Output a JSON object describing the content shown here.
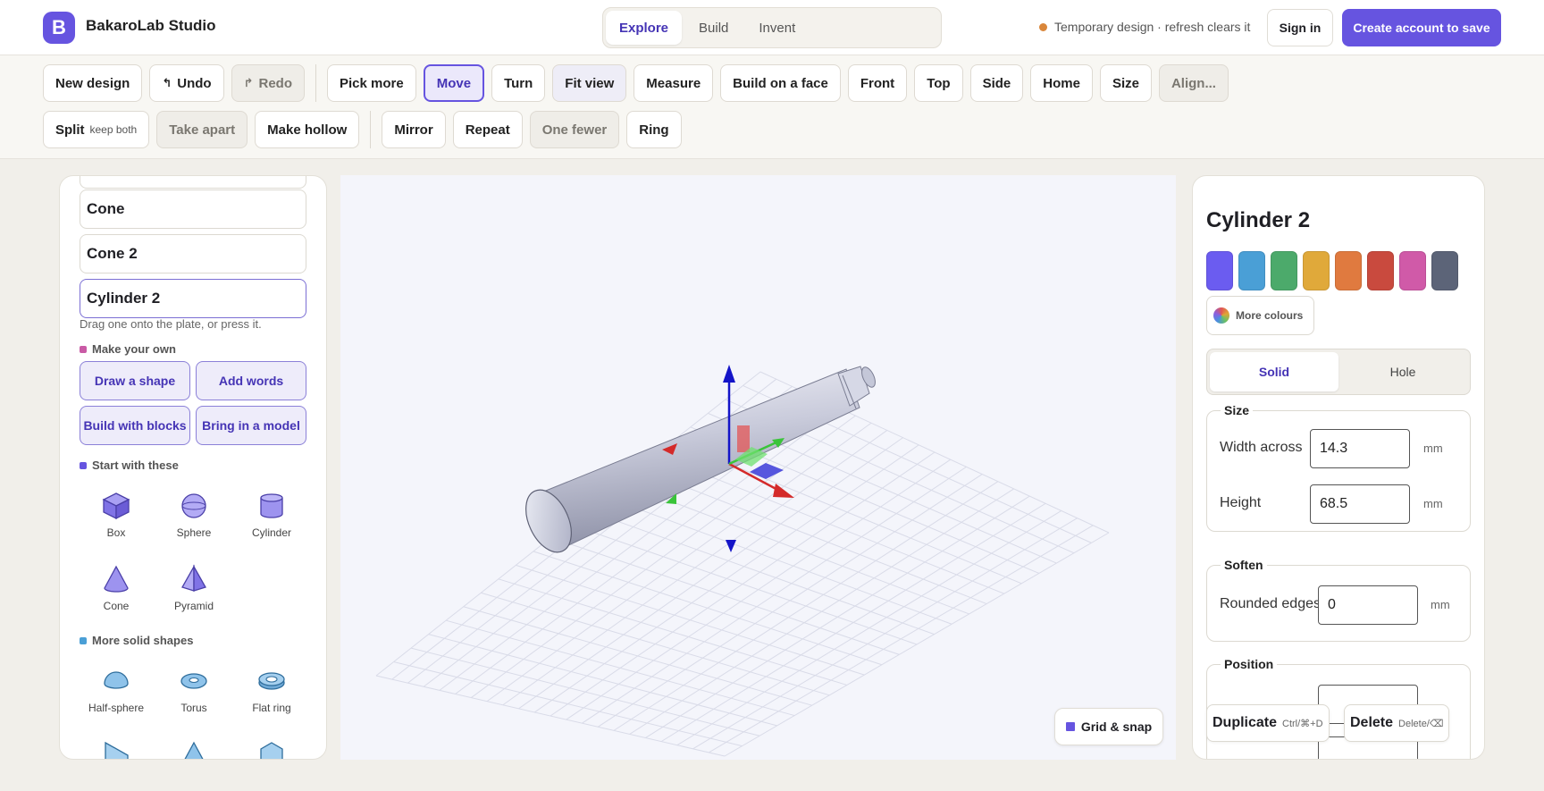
{
  "app": {
    "logo_letter": "B",
    "title": "BakaroLab Studio"
  },
  "modes": [
    "Explore",
    "Build",
    "Invent"
  ],
  "header": {
    "temp_note": "Temporary design · refresh clears it",
    "sign_in": "Sign in",
    "create_account": "Create account to save"
  },
  "toolbar": {
    "row1": [
      "New design",
      "Undo",
      "Redo",
      "Pick more",
      "Move",
      "Turn",
      "Fit view",
      "Measure",
      "Build on a face",
      "Front",
      "Top",
      "Side",
      "Home",
      "Size",
      "Align..."
    ],
    "split": "Split",
    "split_sub": "keep both",
    "row2": [
      "Take apart",
      "Make hollow",
      "Mirror",
      "Repeat",
      "One fewer",
      "Ring"
    ]
  },
  "left": {
    "items": [
      "Cone",
      "Cone 2",
      "Cylinder 2"
    ],
    "hint": "Drag one onto the plate, or press it.",
    "make_own": "Make your own",
    "make_buttons": [
      "Draw a shape",
      "Add words",
      "Build with blocks",
      "Bring in a model"
    ],
    "start_with": "Start with these",
    "basic_shapes": [
      "Box",
      "Sphere",
      "Cylinder",
      "Cone",
      "Pyramid"
    ],
    "more_solid": "More solid shapes",
    "more_shapes": [
      "Half-sphere",
      "Torus",
      "Flat ring"
    ],
    "section_colors": {
      "make": "#c95aa5",
      "start": "#6654e0",
      "more": "#4a9fd6"
    }
  },
  "viewport": {
    "grid_snap": "Grid & snap"
  },
  "right": {
    "title": "Cylinder 2",
    "colors": [
      "#6b5cf0",
      "#4a9fd6",
      "#4caa6b",
      "#e0a93a",
      "#e07a3f",
      "#c94a3e",
      "#d05aa8",
      "#5c6478"
    ],
    "more_colours": "More colours",
    "mode": [
      "Solid",
      "Hole"
    ],
    "size": {
      "label": "Size",
      "width_label": "Width across",
      "width": "14.3",
      "height_label": "Height",
      "height": "68.5",
      "unit": "mm"
    },
    "soften": {
      "label": "Soften",
      "rounded_label": "Rounded edges",
      "rounded": "0",
      "unit": "mm"
    },
    "position": {
      "label": "Position"
    },
    "duplicate": "Duplicate",
    "duplicate_kbd": "Ctrl/⌘+D",
    "delete": "Delete",
    "delete_kbd": "Delete/⌫"
  }
}
